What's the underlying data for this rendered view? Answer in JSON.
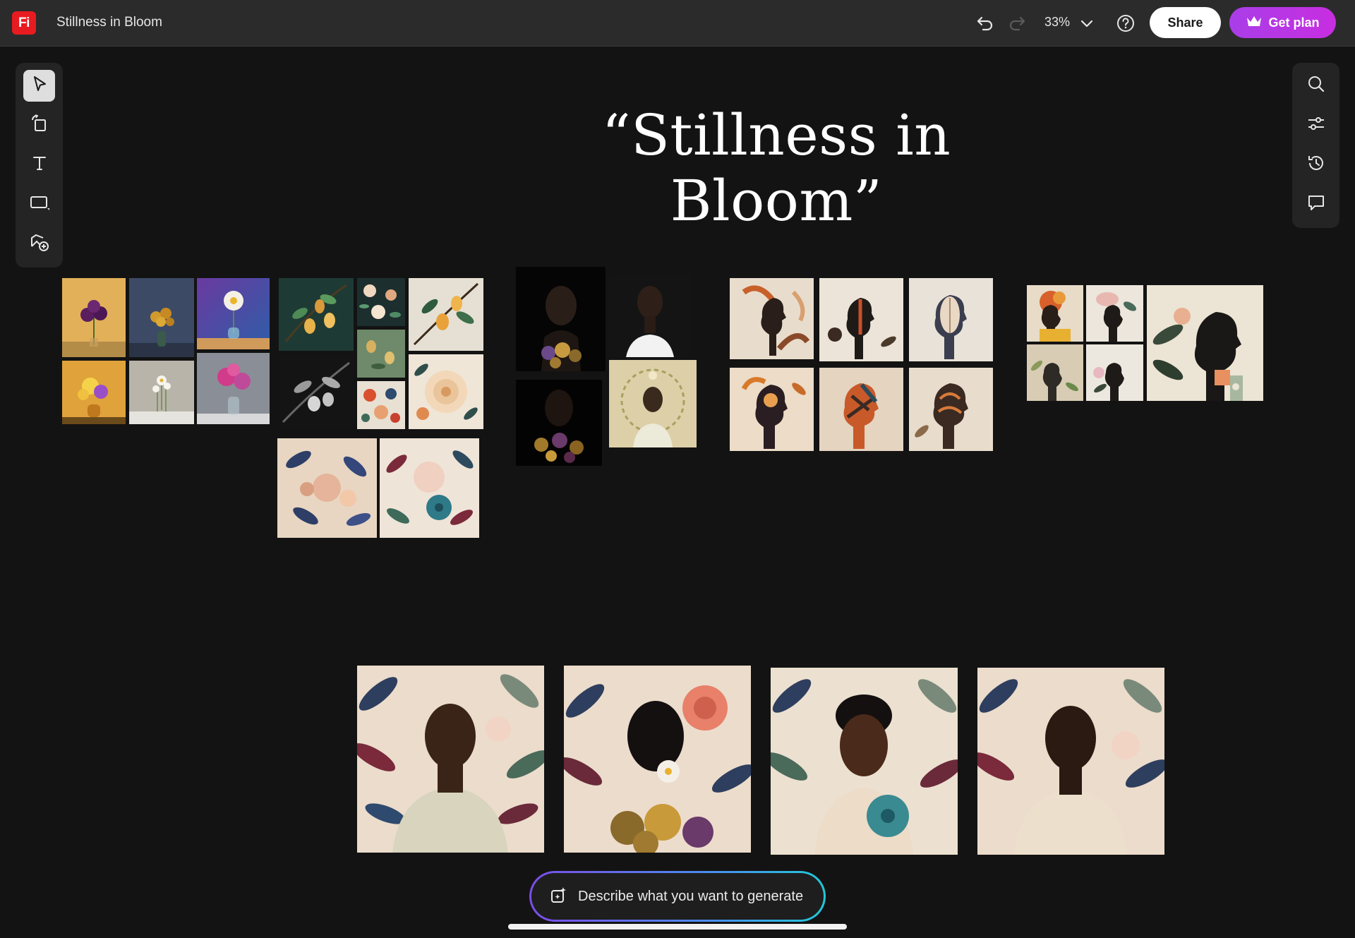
{
  "app": {
    "logo_text": "Fi",
    "document_title": "Stillness in Bloom"
  },
  "topbar": {
    "zoom_level": "33%",
    "share_label": "Share",
    "plan_label": "Get plan"
  },
  "left_tools": [
    {
      "name": "select-tool",
      "icon": "pointer-icon",
      "active": true
    },
    {
      "name": "page-tool",
      "icon": "page-rotate-icon",
      "active": false
    },
    {
      "name": "text-tool",
      "icon": "text-icon",
      "active": false
    },
    {
      "name": "shape-tool",
      "icon": "rectangle-icon",
      "active": false
    },
    {
      "name": "image-tool",
      "icon": "add-image-icon",
      "active": false
    }
  ],
  "right_tools": [
    {
      "name": "search-tool",
      "icon": "search-icon"
    },
    {
      "name": "adjust-tool",
      "icon": "sliders-icon"
    },
    {
      "name": "history-tool",
      "icon": "history-icon"
    },
    {
      "name": "comment-tool",
      "icon": "comment-icon"
    }
  ],
  "canvas": {
    "title": "“Stillness in Bloom”"
  },
  "prompt": {
    "placeholder": "Describe what you want to generate"
  },
  "colors": {
    "accent_purple": "#b23ae6",
    "logo_red": "#e81b20",
    "canvas_bg": "#131313",
    "topbar_bg": "#2b2b2b"
  }
}
